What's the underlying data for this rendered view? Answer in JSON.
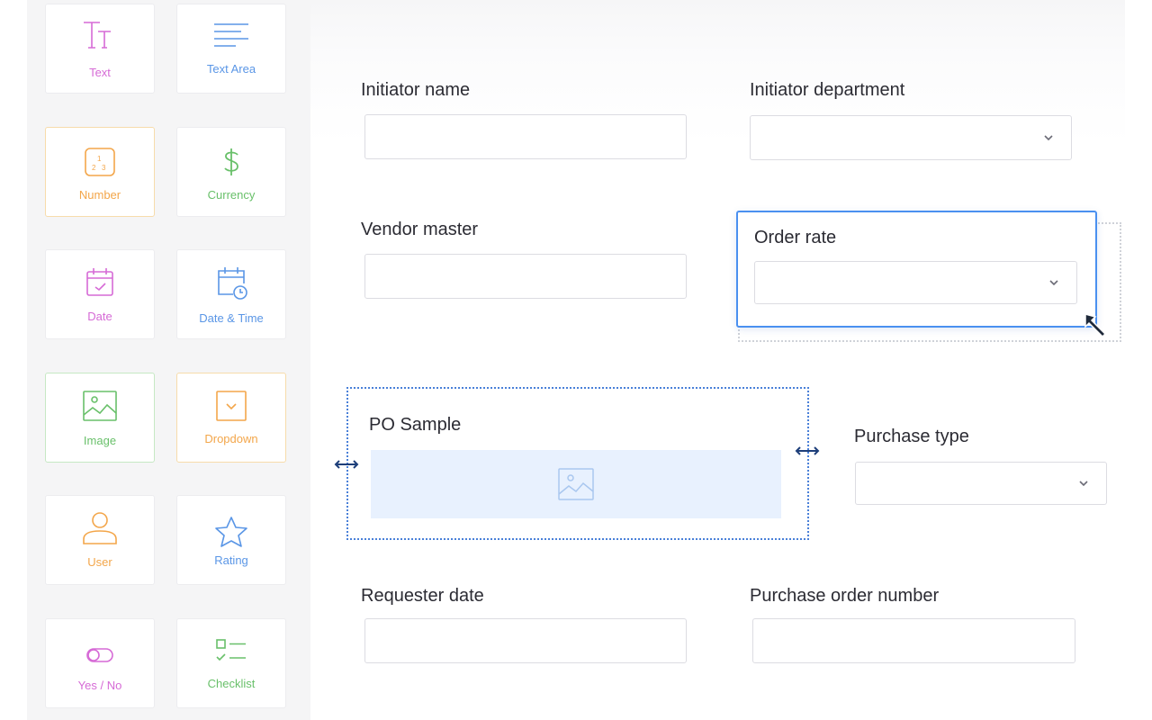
{
  "palette": {
    "items": [
      {
        "label": "Text",
        "icon": "text-format-icon",
        "color": "#d66ad6"
      },
      {
        "label": "Text Area",
        "icon": "text-area-icon",
        "color": "#5a96e6"
      },
      {
        "label": "Number",
        "icon": "number-icon",
        "color": "#f3a64a"
      },
      {
        "label": "Currency",
        "icon": "currency-icon",
        "color": "#69c06a"
      },
      {
        "label": "Date",
        "icon": "calendar-icon",
        "color": "#d66ad6"
      },
      {
        "label": "Date & Time",
        "icon": "calendar-clock-icon",
        "color": "#5a96e6"
      },
      {
        "label": "Image",
        "icon": "image-icon",
        "color": "#69c06a"
      },
      {
        "label": "Dropdown",
        "icon": "dropdown-icon",
        "color": "#f3a64a"
      },
      {
        "label": "User",
        "icon": "user-icon",
        "color": "#f3a64a"
      },
      {
        "label": "Rating",
        "icon": "star-icon",
        "color": "#5a96e6"
      },
      {
        "label": "Yes / No",
        "icon": "toggle-icon",
        "color": "#d66ad6"
      },
      {
        "label": "Checklist",
        "icon": "checklist-icon",
        "color": "#69c06a"
      }
    ]
  },
  "form": {
    "initiator_name": {
      "label": "Initiator name",
      "value": ""
    },
    "initiator_department": {
      "label": "Initiator department",
      "value": ""
    },
    "vendor_master": {
      "label": "Vendor master",
      "value": ""
    },
    "order_rate": {
      "label": "Order rate",
      "value": ""
    },
    "po_sample": {
      "label": "PO Sample"
    },
    "purchase_type": {
      "label": "Purchase type",
      "value": ""
    },
    "requester_date": {
      "label": "Requester date",
      "value": ""
    },
    "purchase_order_number": {
      "label": "Purchase order number",
      "value": ""
    }
  },
  "colors": {
    "selection": "#4a90f0",
    "image_placeholder": "#e8f1fe"
  }
}
